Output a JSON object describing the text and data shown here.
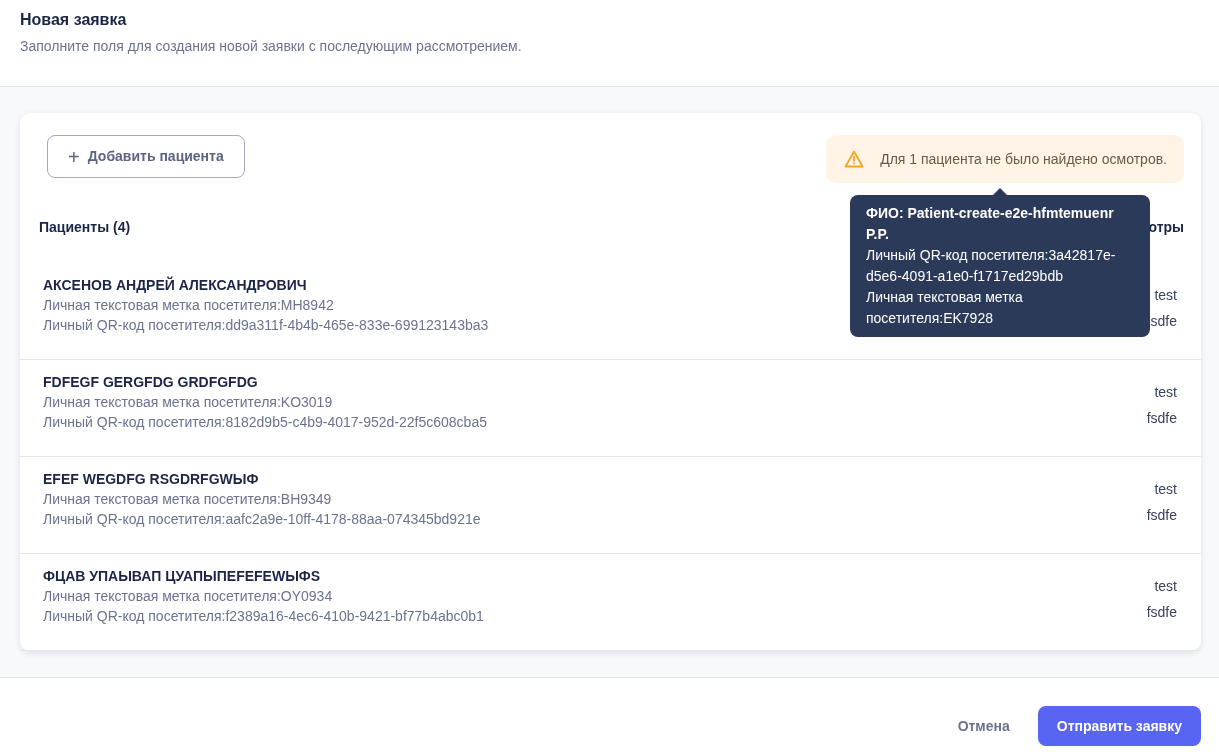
{
  "header": {
    "title": "Новая заявка",
    "subtitle": "Заполните поля для создания новой заявки с последующим рассмотрением."
  },
  "add_button": {
    "label": "Добавить пациента",
    "icon": "+"
  },
  "alert": {
    "text": "Для 1 пациента не было найдено осмотров."
  },
  "tooltip": {
    "title": "ФИО: Patient-create-e2e-hfmtemuenr P.P.",
    "lines": [
      "Личный QR-код посетителя:3a42817e-d5e6-4091-a1e0-f1717ed29bdb",
      "Личная текстовая метка посетителя:EK7928"
    ]
  },
  "table": {
    "columns": [
      "Пациенты (4)",
      "отры"
    ],
    "rows": [
      {
        "name": "АКСЕНОВ АНДРЕЙ АЛЕКСАНДРОВИЧ",
        "tag": "Личная текстовая метка посетителя:MH8942",
        "qr": "Личный QR-код посетителя:dd9a311f-4b4b-465e-833e-699123143ba3",
        "visits": [
          "test",
          "sdfe"
        ]
      },
      {
        "name": "FDFEGF GERGFDG GRDFGFDG",
        "tag": "Личная текстовая метка посетителя:KO3019",
        "qr": "Личный QR-код посетителя:8182d9b5-c4b9-4017-952d-22f5c608cba5",
        "visits": [
          "test",
          "fsdfe"
        ]
      },
      {
        "name": "EFEF WEGDFG RSGDRFGWЫФ",
        "tag": "Личная текстовая метка посетителя:BH9349",
        "qr": "Личный QR-код посетителя:aafc2a9e-10ff-4178-88aa-074345bd921e",
        "visits": [
          "test",
          "fsdfe"
        ]
      },
      {
        "name": "ФЦАВ УПАЫВАП ЦУАПЫПЕFEFEWЫФS",
        "tag": "Личная текстовая метка посетителя:OY0934",
        "qr": "Личный QR-код посетителя:f2389a16-4ec6-410b-9421-bf77b4abc0b1",
        "visits": [
          "test",
          "fsdfe"
        ]
      }
    ]
  },
  "footer": {
    "cancel": "Отмена",
    "submit": "Отправить заявку"
  }
}
